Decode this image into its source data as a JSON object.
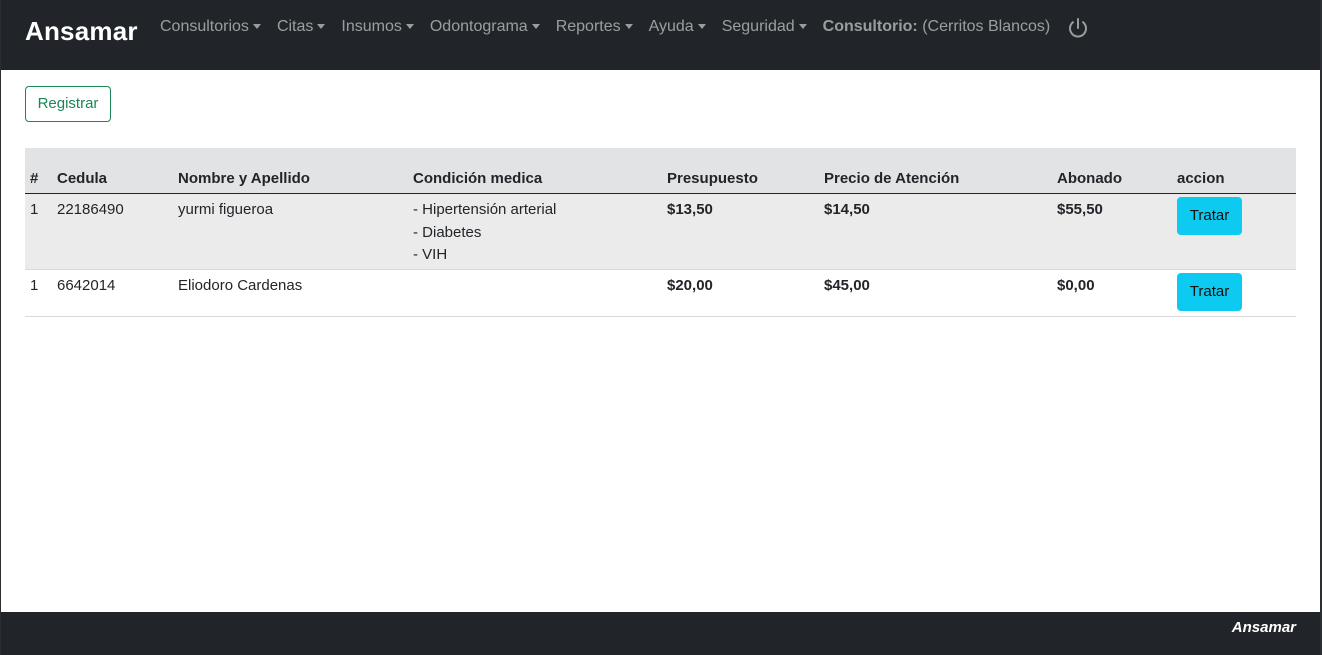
{
  "navbar": {
    "brand": "Ansamar",
    "menus": [
      {
        "label": "Consultorios"
      },
      {
        "label": "Citas"
      },
      {
        "label": "Insumos"
      },
      {
        "label": "Odontograma"
      },
      {
        "label": "Reportes"
      },
      {
        "label": "Ayuda"
      },
      {
        "label": "Seguridad"
      }
    ],
    "consultorio_label": "Consultorio:",
    "consultorio_value": "(Cerritos Blancos)",
    "power_icon": "power-icon"
  },
  "actions": {
    "register_label": "Registrar"
  },
  "table": {
    "headers": [
      "#",
      "Cedula",
      "Nombre y Apellido",
      "Condición medica",
      "Presupuesto",
      "Precio de Atención",
      "Abonado",
      "accion"
    ],
    "rows": [
      {
        "num": "1",
        "cedula": "22186490",
        "nombre": "yurmi figueroa",
        "condiciones": [
          "- Hipertensión arterial",
          "- Diabetes",
          "- VIH"
        ],
        "presupuesto": "$13,50",
        "precio": "$14,50",
        "abonado": "$55,50",
        "accion": "Tratar"
      },
      {
        "num": "1",
        "cedula": "6642014",
        "nombre": "Eliodoro Cardenas",
        "condiciones": [],
        "presupuesto": "$20,00",
        "precio": "$45,00",
        "abonado": "$0,00",
        "accion": "Tratar"
      }
    ]
  },
  "footer": {
    "brand": "Ansamar"
  },
  "colors": {
    "navbar_bg": "#212529",
    "success": "#198754",
    "info": "#0dcaf0",
    "header_row_bg": "#e2e3e5"
  }
}
